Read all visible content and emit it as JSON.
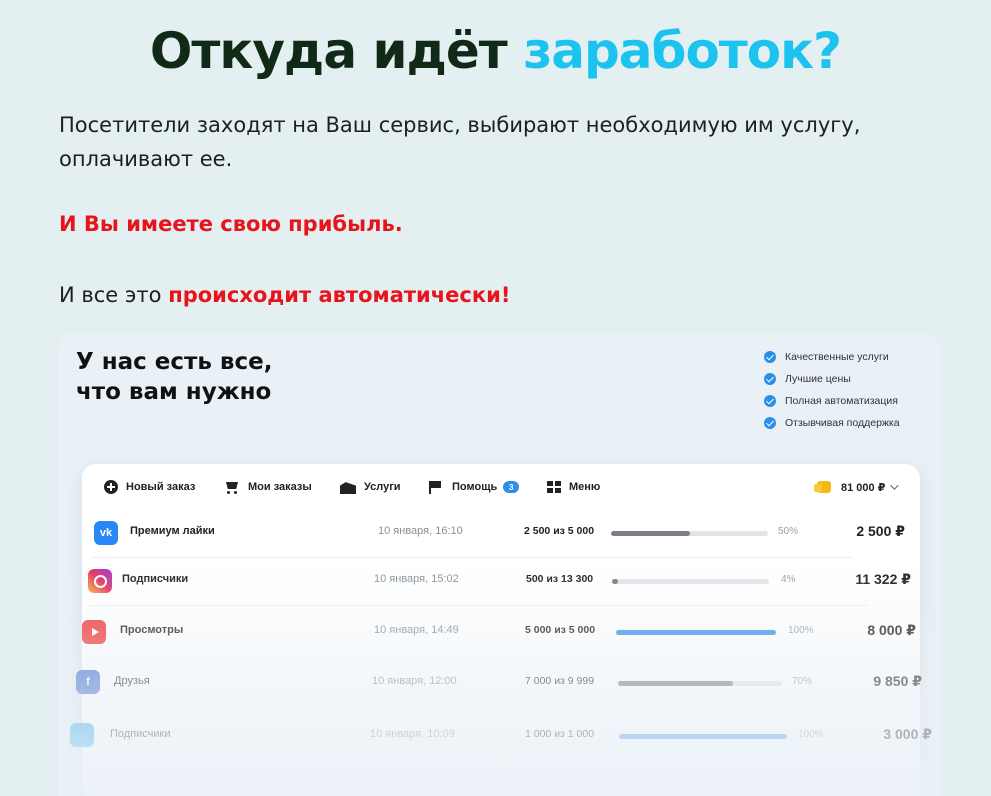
{
  "headline": {
    "part1": "Откуда идёт",
    "part2": "заработок?"
  },
  "intro": "Посетители заходят на Ваш сервис, выбирают необходимую им услугу, оплачивают ее.",
  "profit_line": "И Вы имеете свою прибыль.",
  "auto_line": {
    "prefix": "И все это",
    "highlight": "происходит автоматически!"
  },
  "mockup": {
    "title_line1": "У нас есть все,",
    "title_line2": "что вам нужно",
    "features": [
      "Качественные услуги",
      "Лучшие цены",
      "Полная автоматизация",
      "Отзывчивая поддержка"
    ],
    "nav": {
      "new_order": "Новый заказ",
      "my_orders": "Мои заказы",
      "services": "Услуги",
      "help": "Помощь",
      "help_badge": "3",
      "menu": "Меню",
      "balance": "81 000 ₽"
    },
    "orders": [
      {
        "platform_icon": "vk-icon",
        "service": "Премиум лайки",
        "date": "10 января, 16:10",
        "progress_text": "2 500 из 5 000",
        "progress": 0.5,
        "percent": "50%",
        "price": "2 500 ₽",
        "bar_color": "#7a7f88"
      },
      {
        "platform_icon": "instagram-icon",
        "service": "Подписчики",
        "date": "10 января, 15:02",
        "progress_text": "500 из 13 300",
        "progress": 0.04,
        "percent": "4%",
        "price": "11 322 ₽",
        "bar_color": "#7a7f88"
      },
      {
        "platform_icon": "youtube-icon",
        "service": "Просмотры",
        "date": "10 января, 14:49",
        "progress_text": "5 000 из 5 000",
        "progress": 1.0,
        "percent": "100%",
        "price": "8 000 ₽",
        "bar_color": "#3d93ec"
      },
      {
        "platform_icon": "facebook-icon",
        "service": "Друзья",
        "date": "10 января, 12:00",
        "progress_text": "7 000 из 9 999",
        "progress": 0.7,
        "percent": "70%",
        "price": "9 850 ₽",
        "bar_color": "#7a7f88"
      },
      {
        "platform_icon": "twitter-icon",
        "service": "Подписчики",
        "date": "10 января, 10:09",
        "progress_text": "1 000 из 1 000",
        "progress": 1.0,
        "percent": "100%",
        "price": "3 000 ₽",
        "bar_color": "#3d93ec"
      }
    ]
  }
}
